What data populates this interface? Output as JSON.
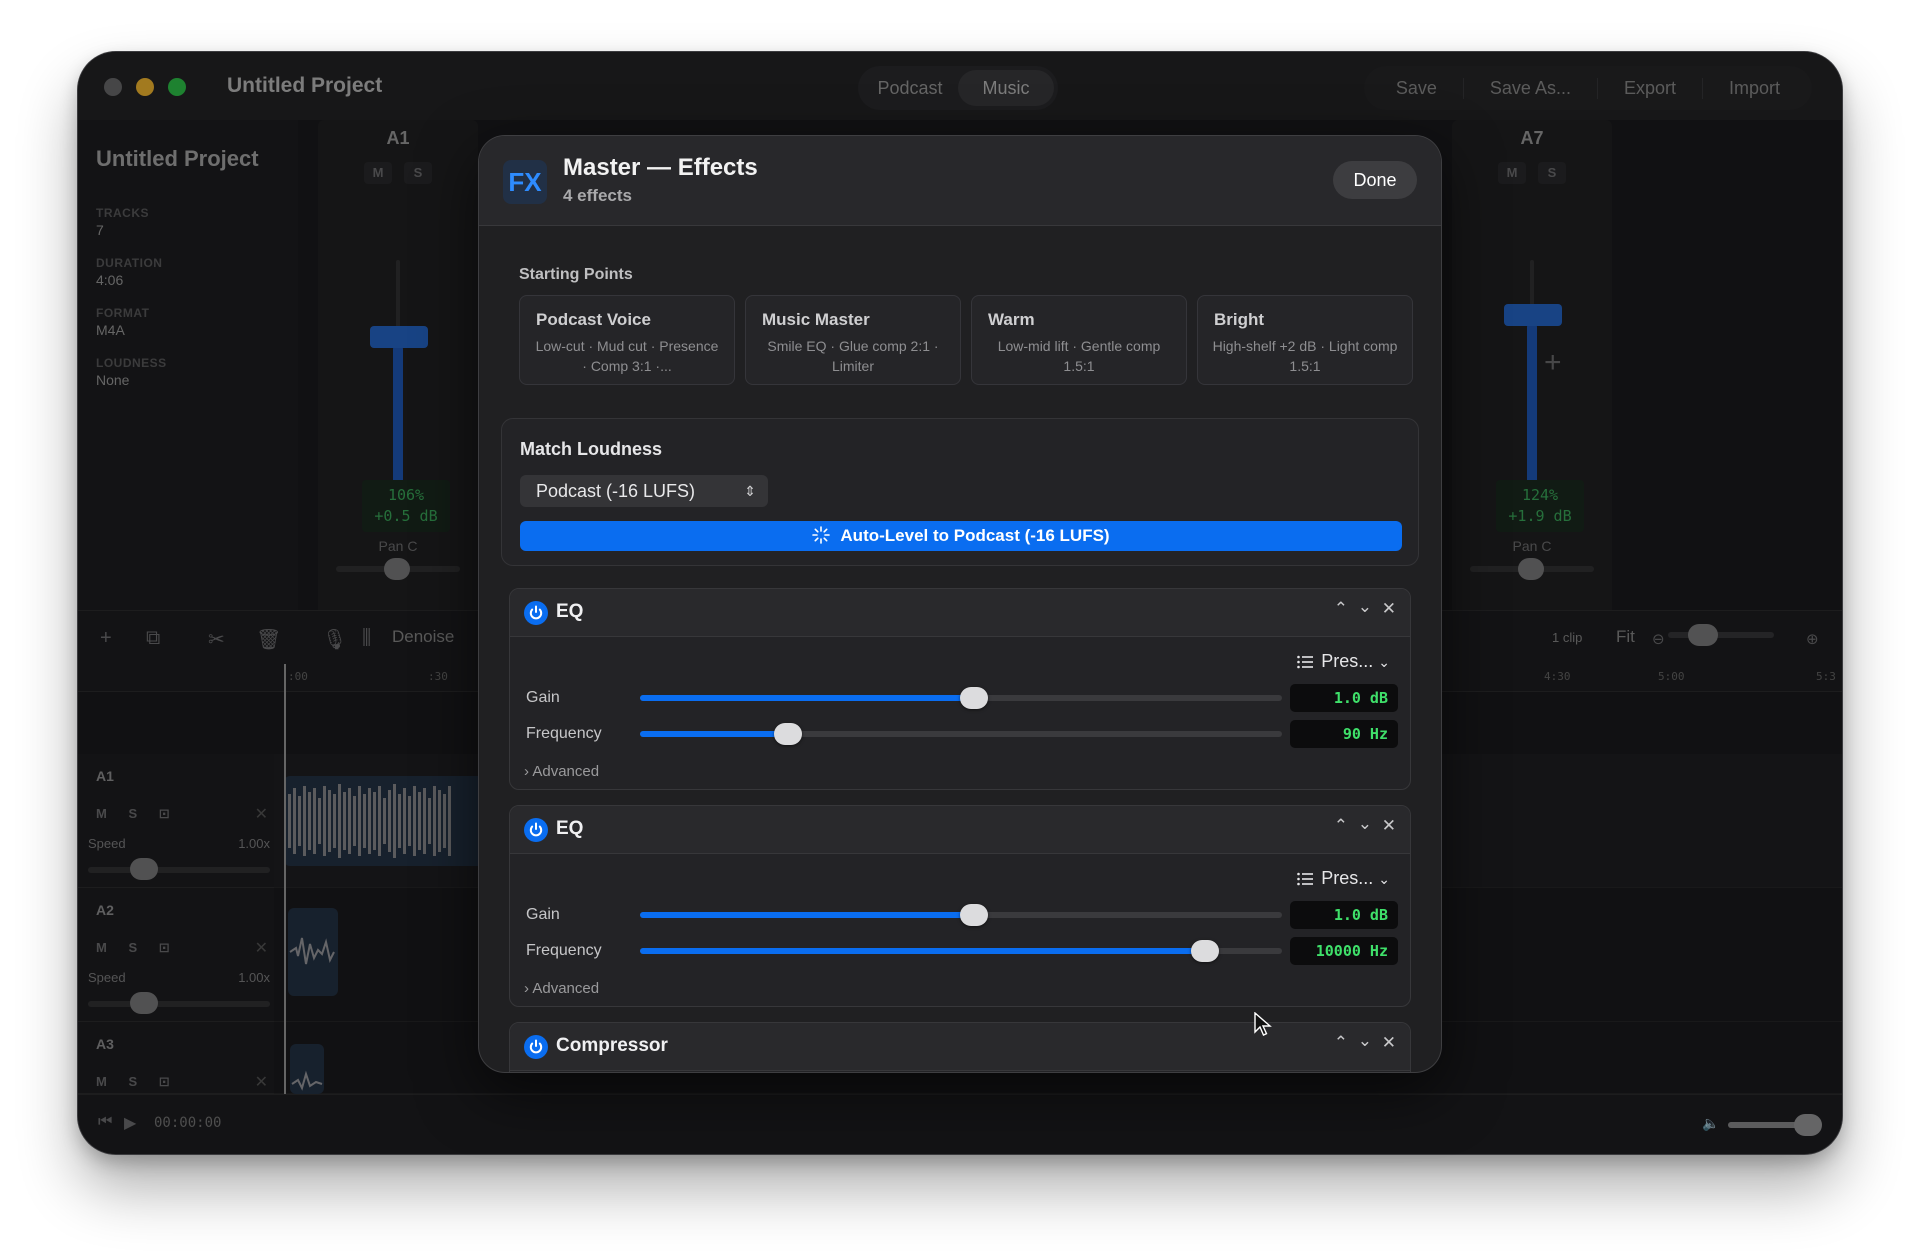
{
  "window": {
    "title": "Untitled Project",
    "modes": [
      {
        "label": "Podcast",
        "active": false
      },
      {
        "label": "Music",
        "active": true
      }
    ],
    "actions": [
      "Save",
      "Save As...",
      "Export",
      "Import"
    ]
  },
  "project": {
    "title": "Untitled Project",
    "fields": [
      {
        "label": "TRACKS",
        "value": "7"
      },
      {
        "label": "DURATION",
        "value": "4:06"
      },
      {
        "label": "FORMAT",
        "value": "M4A"
      },
      {
        "label": "LOUDNESS",
        "value": "None"
      }
    ]
  },
  "mixer": {
    "strips": [
      {
        "name": "A1",
        "mute": "M",
        "solo": "S",
        "level_pct": "106%",
        "level_db": "+0.5 dB",
        "pan": "Pan C"
      },
      {
        "name": "A7",
        "mute": "M",
        "solo": "S",
        "level_pct": "124%",
        "level_db": "+1.9 dB",
        "pan": "Pan C"
      }
    ],
    "add_icon": "+"
  },
  "toolbar": {
    "denoise_label": "Denoise",
    "clip_count": "1 clip",
    "fit_label": "Fit",
    "ruler_left": [
      ":00",
      ":30"
    ],
    "ruler_right": [
      "4:30",
      "5:00",
      "5:3"
    ]
  },
  "tracks": [
    {
      "name": "A1",
      "mute": "M",
      "solo": "S",
      "speed_label": "Speed",
      "speed_value": "1.00x"
    },
    {
      "name": "A2",
      "mute": "M",
      "solo": "S",
      "speed_label": "Speed",
      "speed_value": "1.00x"
    },
    {
      "name": "A3",
      "mute": "M",
      "solo": "S"
    }
  ],
  "transport": {
    "time": "00:00:00",
    "volume": 0.9
  },
  "modal": {
    "badge": "FX",
    "title": "Master — Effects",
    "subtitle": "4 effects",
    "done_label": "Done",
    "starting_points_label": "Starting Points",
    "presets": [
      {
        "name": "Podcast Voice",
        "desc": "Low-cut · Mud cut · Presence · Comp 3:1 ·..."
      },
      {
        "name": "Music Master",
        "desc": "Smile EQ · Glue comp 2:1 · Limiter"
      },
      {
        "name": "Warm",
        "desc": "Low-mid lift · Gentle comp 1.5:1"
      },
      {
        "name": "Bright",
        "desc": "High-shelf +2 dB · Light comp 1.5:1"
      }
    ],
    "loudness": {
      "title": "Match Loudness",
      "selected": "Podcast (-16 LUFS)",
      "auto_level_label": "Auto-Level to Podcast (-16 LUFS)"
    },
    "effects": [
      {
        "name": "EQ",
        "presets_label": "Pres...",
        "params": [
          {
            "label": "Gain",
            "value": "1.0 dB",
            "level": 0.52
          },
          {
            "label": "Frequency",
            "value": "90 Hz",
            "level": 0.23
          }
        ],
        "advanced_label": "Advanced"
      },
      {
        "name": "EQ",
        "presets_label": "Pres...",
        "params": [
          {
            "label": "Gain",
            "value": "1.0 dB",
            "level": 0.52
          },
          {
            "label": "Frequency",
            "value": "10000 Hz",
            "level": 0.88
          }
        ],
        "advanced_label": "Advanced"
      },
      {
        "name": "Compressor"
      }
    ]
  },
  "colors": {
    "accent": "#0a6df0",
    "readout_green": "#3fe06a",
    "background": "#1b1b1d",
    "traffic_close": "#6b6b6d",
    "traffic_min": "#f6b930",
    "traffic_max": "#2ec64a"
  },
  "icons": [
    "fx-icon",
    "power-icon",
    "chevron-up-icon",
    "chevron-down-icon",
    "close-icon",
    "list-icon",
    "sparkle-icon",
    "plus-icon",
    "scissors-icon",
    "trash-icon",
    "mic-icon",
    "waveform-icon",
    "play-icon",
    "skip-back-icon",
    "speaker-icon",
    "zoom-out-icon",
    "zoom-in-icon",
    "lock-icon",
    "duplicate-icon"
  ]
}
